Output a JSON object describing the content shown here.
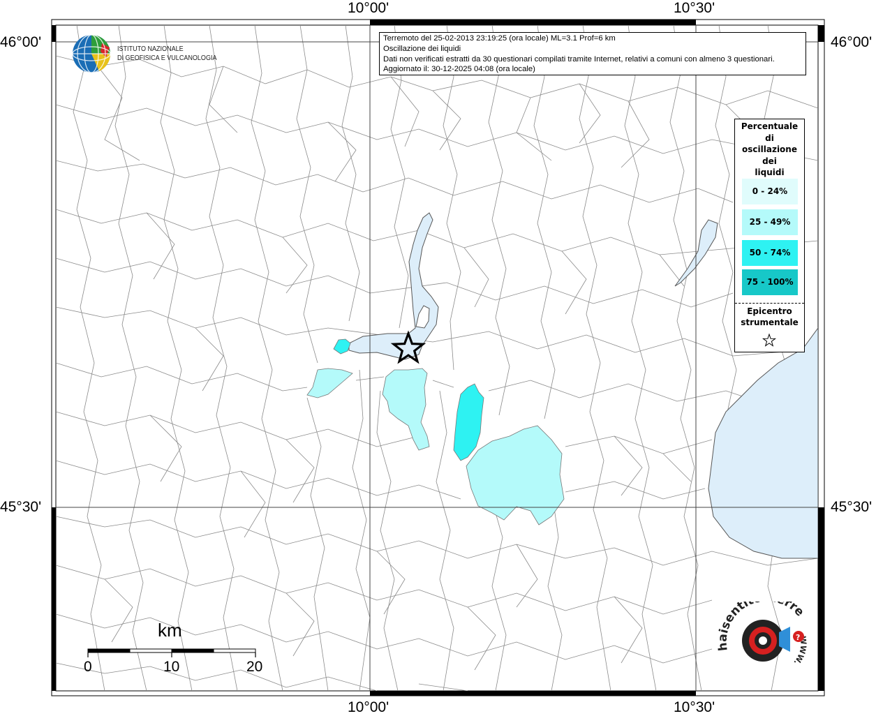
{
  "map": {
    "tick_labels": {
      "lon": [
        "10°00'",
        "10°30'"
      ],
      "lat": [
        "46°00'",
        "45°30'"
      ]
    },
    "info": {
      "line1": "Terremoto del 25-02-2013 23:19:25 (ora locale) ML=3.1 Prof=6 km",
      "line2": "Oscillazione dei liquidi",
      "line3": "Dati non verificati estratti da 30 questionari compilati tramite Internet, relativi a comuni con almeno 3 questionari.",
      "line4": "Aggiornato il: 30-12-2025 04:08 (ora locale)"
    },
    "legend": {
      "title_lines": [
        "Percentuale",
        "di",
        "oscillazione",
        "dei",
        "liquidi"
      ],
      "classes": [
        {
          "label": "0 - 24%",
          "color": "#e0fcfc"
        },
        {
          "label": "25 - 49%",
          "color": "#b4fafa"
        },
        {
          "label": "50 - 74%",
          "color": "#2ef2f2"
        },
        {
          "label": "75 - 100%",
          "color": "#17c8c8"
        }
      ],
      "epicenter_lines": [
        "Epicentro",
        "strumentale"
      ]
    },
    "logo": {
      "line1": "ISTITUTO NAZIONALE",
      "line2": "DI GEOFISICA E VULCANOLOGIA"
    },
    "scale_bar": {
      "unit": "km",
      "labels": [
        "0",
        "10",
        "20"
      ]
    },
    "watermark_logo": {
      "text": "haisentitoilterremoto.it",
      "url_text": "WWW.",
      "accent_color": "#d62020"
    },
    "colors": {
      "lake": "#ddeefa",
      "boundaries": "#8a8a8a"
    }
  }
}
